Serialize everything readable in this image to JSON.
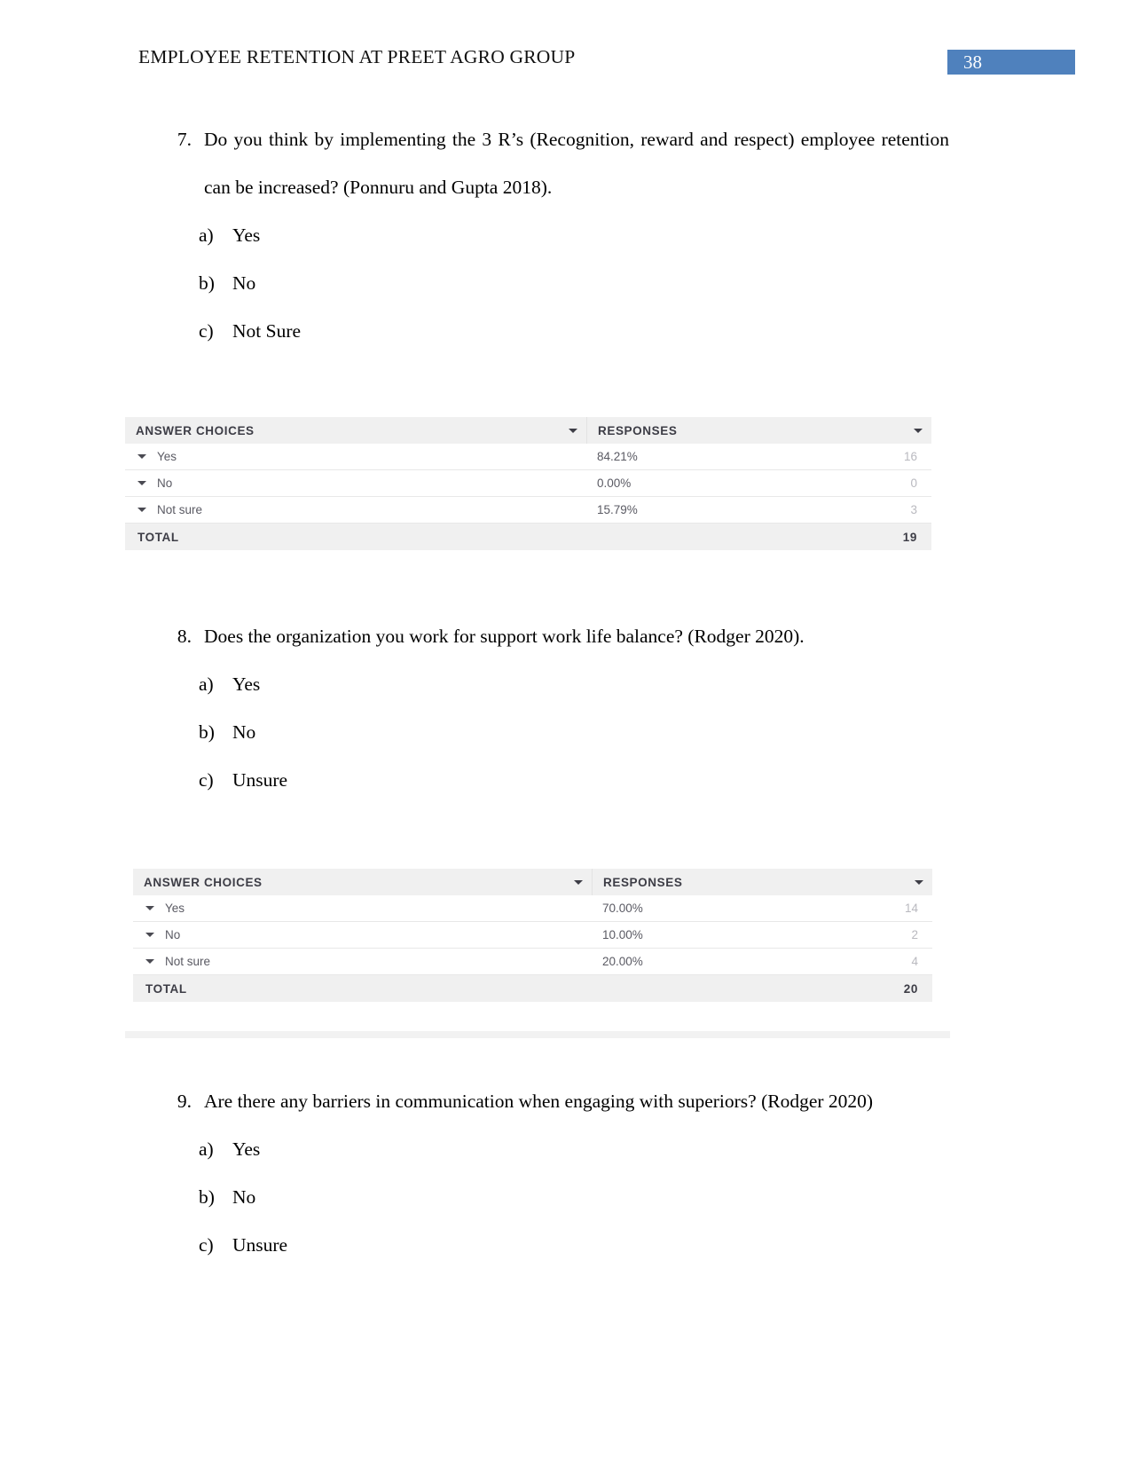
{
  "header": {
    "title": "EMPLOYEE RETENTION AT PREET AGRO GROUP",
    "page_number": "38",
    "badge_color": "#4f81bd"
  },
  "table_labels": {
    "answer_choices": "ANSWER CHOICES",
    "responses": "RESPONSES",
    "total": "TOTAL",
    "sort_caret_icon": "chevron-down-icon"
  },
  "questions": [
    {
      "number": "7.",
      "text": "Do you think by implementing the 3 R’s (Recognition, reward and respect) employee retention can be increased? (Ponnuru and Gupta 2018).",
      "options": [
        {
          "label": "a)",
          "text": "Yes"
        },
        {
          "label": "b)",
          "text": "No"
        },
        {
          "label": "c)",
          "text": "Not Sure"
        }
      ],
      "table": {
        "rows": [
          {
            "choice": "Yes",
            "percent": "84.21%",
            "count": "16"
          },
          {
            "choice": "No",
            "percent": "0.00%",
            "count": "0"
          },
          {
            "choice": "Not sure",
            "percent": "15.79%",
            "count": "3"
          }
        ],
        "total_label": "TOTAL",
        "total_value": "19"
      }
    },
    {
      "number": "8.",
      "text": "Does the organization you work for support work life balance? (Rodger 2020).",
      "options": [
        {
          "label": "a)",
          "text": "Yes"
        },
        {
          "label": "b)",
          "text": "No"
        },
        {
          "label": "c)",
          "text": "Unsure"
        }
      ],
      "table": {
        "rows": [
          {
            "choice": "Yes",
            "percent": "70.00%",
            "count": "14"
          },
          {
            "choice": "No",
            "percent": "10.00%",
            "count": "2"
          },
          {
            "choice": "Not sure",
            "percent": "20.00%",
            "count": "4"
          }
        ],
        "total_label": "TOTAL",
        "total_value": "20"
      }
    },
    {
      "number": "9.",
      "text": "Are there any barriers in communication when engaging with superiors? (Rodger 2020)",
      "options": [
        {
          "label": "a)",
          "text": "Yes"
        },
        {
          "label": "b)",
          "text": "No"
        },
        {
          "label": "c)",
          "text": "Unsure"
        }
      ]
    }
  ]
}
